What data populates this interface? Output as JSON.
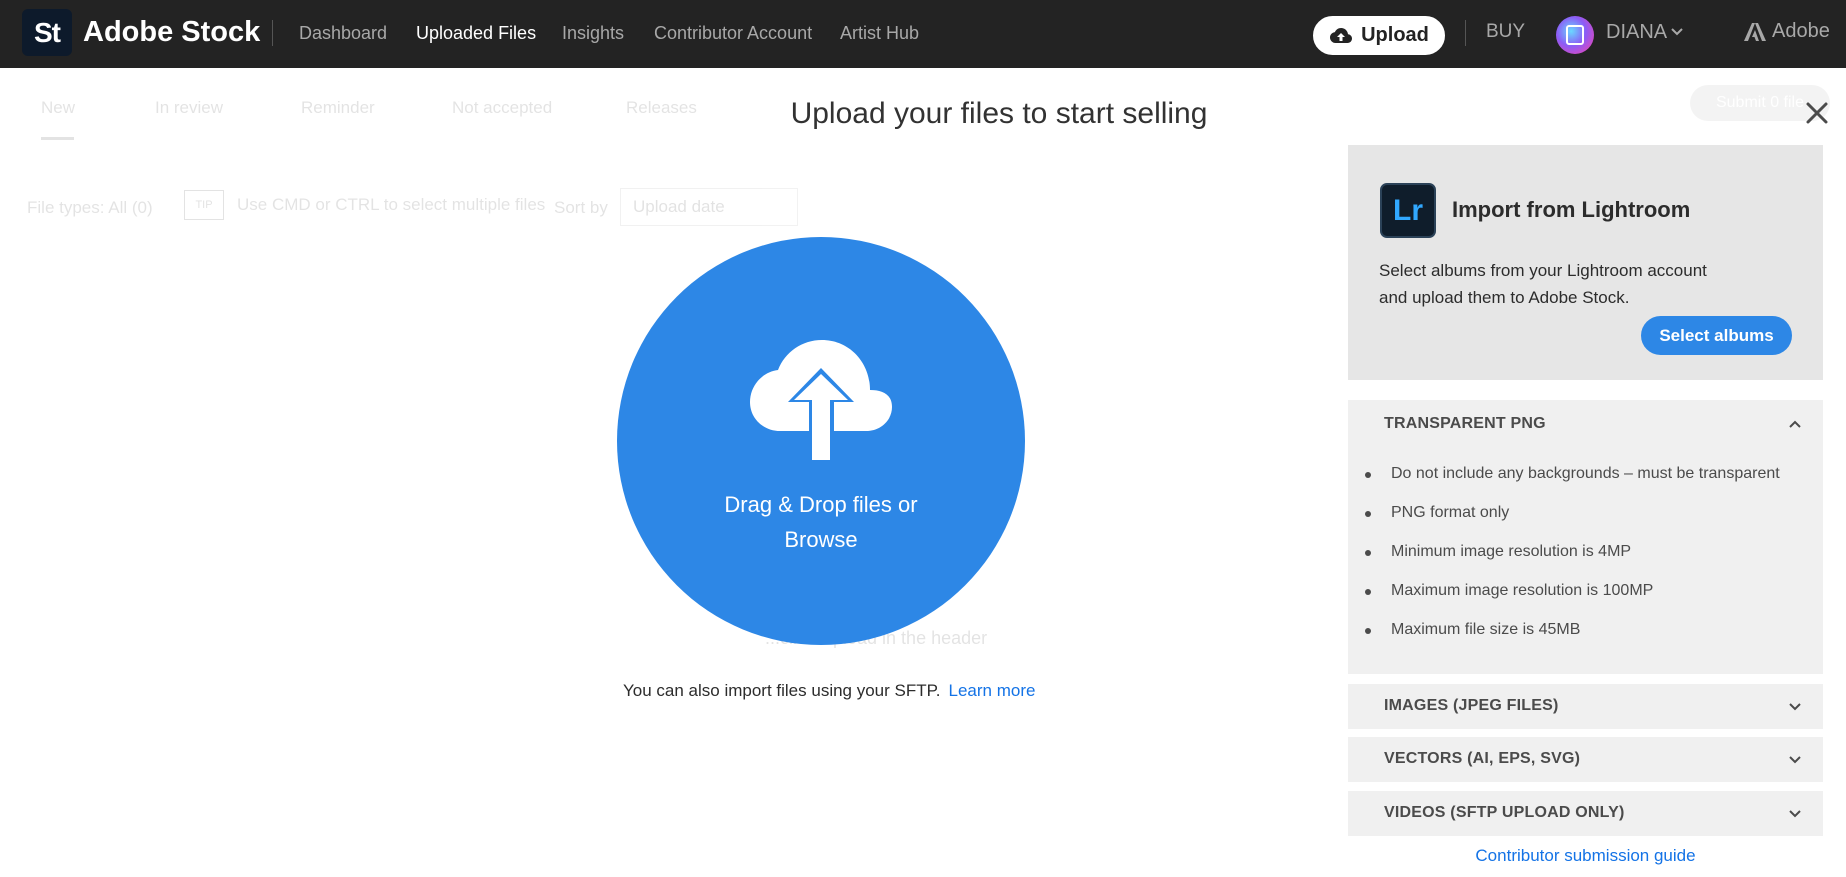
{
  "header": {
    "logo_text": "St",
    "brand": "Adobe Stock",
    "nav": [
      {
        "label": "Dashboard",
        "active": false
      },
      {
        "label": "Uploaded Files",
        "active": true
      },
      {
        "label": "Insights",
        "active": false
      },
      {
        "label": "Contributor Account",
        "active": false
      },
      {
        "label": "Artist Hub",
        "active": false
      }
    ],
    "upload_label": "Upload",
    "buy_label": "BUY",
    "user_name": "DIANA",
    "adobe_label": "Adobe"
  },
  "background": {
    "tabs": [
      "New",
      "In review",
      "Reminder",
      "Not accepted",
      "Releases"
    ],
    "submit_label": "Submit 0 file",
    "file_types": "File types: All (0)",
    "tip": "TIP",
    "tip_text": "Use CMD or CTRL to select multiple files",
    "sort_by": "Sort by",
    "sort_value": "Upload date",
    "hint": "...click Upload in the header"
  },
  "modal": {
    "title": "Upload your files to start selling",
    "drop_line1": "Drag & Drop files or",
    "drop_line2": "Browse",
    "sftp_text": "You can also import files using your SFTP.",
    "learn_more": "Learn more"
  },
  "lightroom": {
    "logo_text": "Lr",
    "title": "Import from Lightroom",
    "description": "Select albums from your Lightroom account and upload them to Adobe Stock.",
    "button": "Select albums"
  },
  "accordions": {
    "png": {
      "title": "TRANSPARENT PNG",
      "items": [
        "Do not include any backgrounds – must be transparent",
        "PNG format only",
        "Minimum image resolution is 4MP",
        "Maximum image resolution is 100MP",
        "Maximum file size is 45MB"
      ]
    },
    "images": {
      "title": "IMAGES (JPEG FILES)"
    },
    "vectors": {
      "title": "VECTORS (AI, EPS, SVG)"
    },
    "videos": {
      "title": "VIDEOS (SFTP UPLOAD ONLY)"
    }
  },
  "guide_link": "Contributor submission guide",
  "colors": {
    "header_bg": "#232323",
    "accent_blue": "#2d87e6",
    "link_blue": "#1473e6",
    "panel_bg": "#e6e6e6",
    "accordion_bg": "#f0f0f0"
  },
  "icons": [
    "cloud-upload-icon",
    "close-icon",
    "chevron-down-icon",
    "chevron-up-icon",
    "adobe-logo-icon"
  ]
}
